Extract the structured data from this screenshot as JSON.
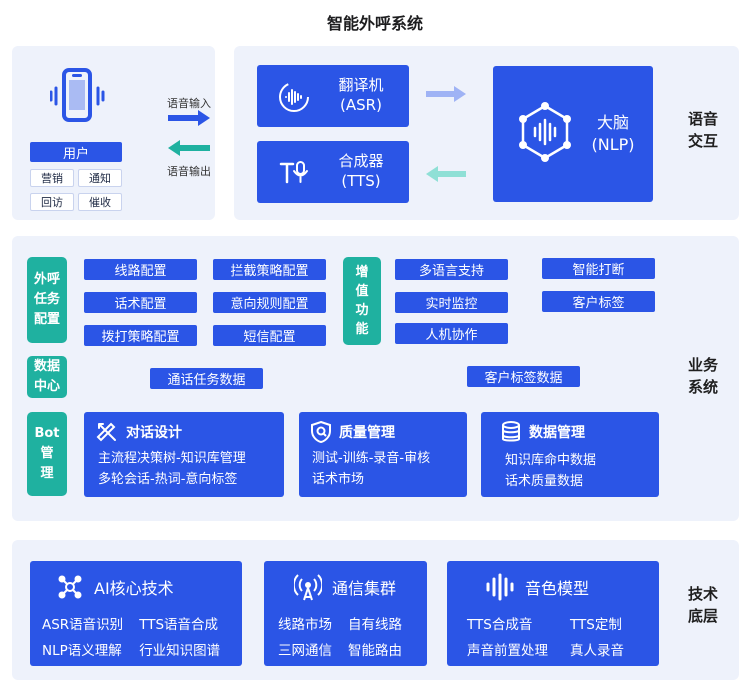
{
  "title": "智能外呼系统",
  "voice": {
    "user": {
      "label": "用户",
      "chips": [
        "营销",
        "通知",
        "回访",
        "催收"
      ]
    },
    "arrow_in": "语音输入",
    "arrow_out": "语音输出",
    "asr": {
      "line1": "翻译机",
      "line2": "(ASR)"
    },
    "tts": {
      "line1": "合成器",
      "line2": "(TTS)"
    },
    "nlp": {
      "line1": "大脑",
      "line2": "(NLP)"
    },
    "side": [
      "语音",
      "交互"
    ]
  },
  "business": {
    "side": [
      "业务",
      "系统"
    ],
    "config_label": [
      "外呼",
      "任务",
      "配置"
    ],
    "config_items": [
      "线路配置",
      "拦截策略配置",
      "话术配置",
      "意向规则配置",
      "拨打策略配置",
      "短信配置"
    ],
    "value_label": [
      "增",
      "值",
      "功",
      "能"
    ],
    "value_items": [
      "多语言支持",
      "实时监控",
      "人机协作"
    ],
    "extra_items": [
      "智能打断",
      "客户标签"
    ],
    "data_label": [
      "数据",
      "中心"
    ],
    "data_items": [
      "通话任务数据",
      "客户标签数据"
    ],
    "bot_label": [
      "Bot",
      "管",
      "理"
    ],
    "cards": [
      {
        "title": "对话设计",
        "icon": "pencil-ruler-icon",
        "lines": [
          "主流程决策树-知识库管理",
          "多轮会话-热词-意向标签"
        ]
      },
      {
        "title": "质量管理",
        "icon": "shield-icon",
        "lines": [
          "测试-训练-录音-审核",
          "话术市场"
        ]
      },
      {
        "title": "数据管理",
        "icon": "database-icon",
        "lines": [
          "知识库命中数据",
          "话术质量数据"
        ]
      }
    ]
  },
  "tech": {
    "side": [
      "技术",
      "底层"
    ],
    "cards": [
      {
        "title": "AI核心技术",
        "icon": "ai-network-icon",
        "items": [
          "ASR语音识别",
          "TTS语音合成",
          "NLP语义理解",
          "行业知识图谱"
        ]
      },
      {
        "title": "通信集群",
        "icon": "signal-tower-icon",
        "items": [
          "线路市场",
          "自有线路",
          "三网通信",
          "智能路由"
        ]
      },
      {
        "title": "音色模型",
        "icon": "sound-wave-icon",
        "items": [
          "TTS合成音",
          "TTS定制",
          "声音前置处理",
          "真人录音"
        ]
      }
    ]
  },
  "colors": {
    "primary": "#2b55e6",
    "teal": "#1fb1a0",
    "panel": "#eef2fb",
    "arrow_light": "#9fb3f5",
    "arrow_teal": "#8fe0d6"
  }
}
